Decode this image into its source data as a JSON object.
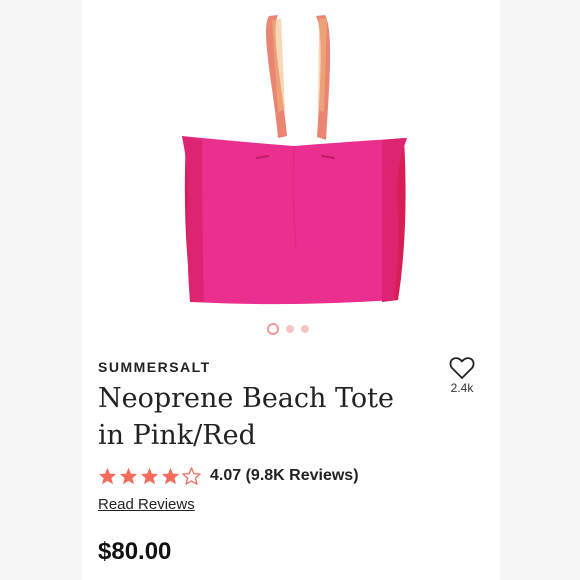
{
  "product": {
    "brand": "SUMMERSALT",
    "title": "Neoprene Beach Tote in Pink/Red",
    "favorites_count": "2.4k",
    "rating_text": "4.07 (9.8K Reviews)",
    "rating_value": 4.07,
    "rating_max": 5,
    "read_reviews": "Read Reviews",
    "price": "$80.00"
  },
  "gallery": {
    "image": "pink-red-neoprene-tote-bag",
    "slides": 3,
    "active_slide": 1
  },
  "icons": {
    "favorite": "heart-outline-icon",
    "star": "star-icon"
  },
  "colors": {
    "star": "#f26b5b",
    "dot_active": "#f09a98",
    "dot": "#f6c5c3",
    "tote_body": "#ea2f8e",
    "tote_side": "#d81f55",
    "strap": "#f08a7a"
  }
}
